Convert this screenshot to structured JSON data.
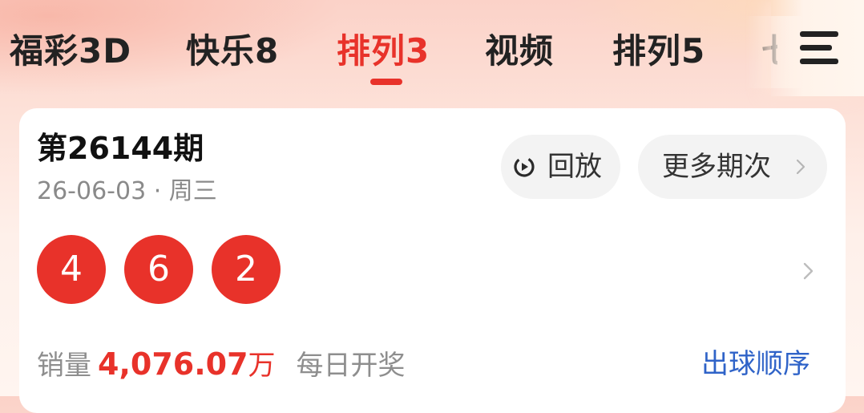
{
  "tabs": [
    {
      "label": "福彩3D",
      "active": false
    },
    {
      "label": "快乐8",
      "active": false
    },
    {
      "label": "排列3",
      "active": true
    },
    {
      "label": "视频",
      "active": false
    },
    {
      "label": "排列5",
      "active": false
    },
    {
      "label": "七",
      "active": false
    }
  ],
  "menu": {
    "icon": "hamburger-menu-icon"
  },
  "card": {
    "issue": "第26144期",
    "date": "26-06-03 · 周三",
    "replay": {
      "label": "回放",
      "icon": "replay-icon"
    },
    "more": {
      "label": "更多期次",
      "icon": "chevron-right-icon"
    },
    "balls": [
      "4",
      "6",
      "2"
    ],
    "sales": {
      "label": "销量",
      "value": "4,076.07",
      "unit": "万",
      "daily": "每日开奖"
    },
    "order_link": "出球顺序"
  },
  "colors": {
    "accent": "#e8322a",
    "link": "#2f63c8",
    "text": "#222222",
    "muted": "#8a8a8a"
  }
}
